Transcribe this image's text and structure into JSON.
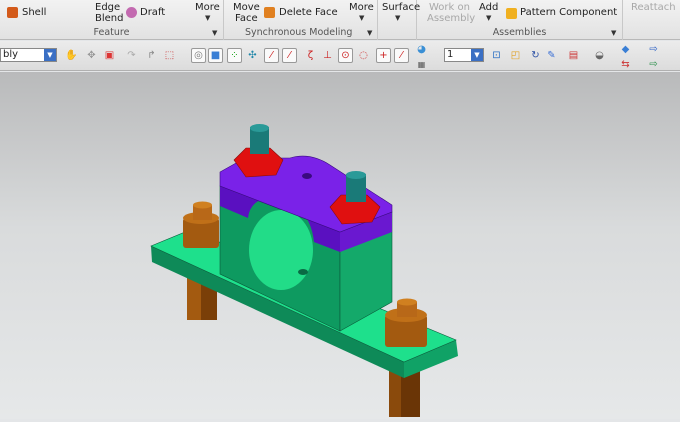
{
  "ribbon": {
    "feature": {
      "shell": "Shell",
      "edge_blend": [
        "Edge",
        "Blend"
      ],
      "draft": "Draft",
      "more": "More",
      "label": "Feature"
    },
    "sync": {
      "move_face": [
        "Move",
        "Face"
      ],
      "delete_face": "Delete Face",
      "more": "More",
      "label": "Synchronous Modeling"
    },
    "surface": {
      "label": "Surface"
    },
    "assemblies": {
      "work_on": [
        "Work on",
        "Assembly"
      ],
      "add": "Add",
      "pattern": "Pattern Component",
      "label": "Assemblies"
    },
    "reattach": "Reattach"
  },
  "toolbar": {
    "filter_value": "bly",
    "layer_value": "1"
  },
  "colors": {
    "base": "#12a36a",
    "cap": "#7a1ee0",
    "nut": "#e01010",
    "stud": "#1a7a78",
    "pin": "#a35a10"
  }
}
